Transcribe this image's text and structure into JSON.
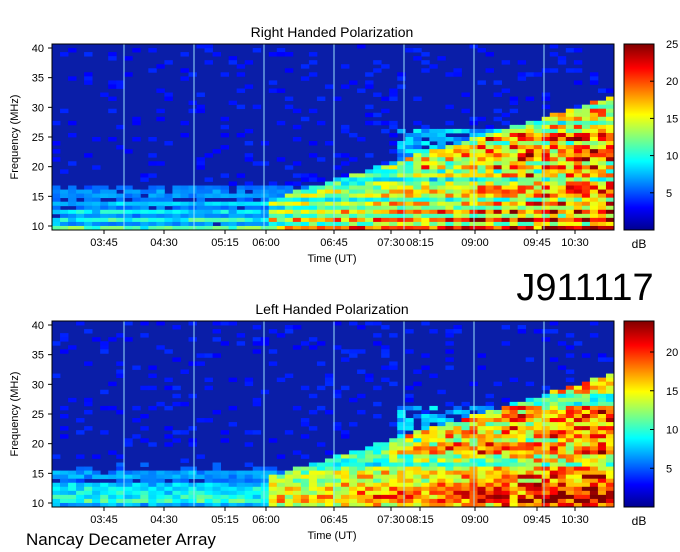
{
  "header": {
    "id_label": "J911117",
    "footer_label": "Nancay Decameter Array"
  },
  "chart_data": [
    {
      "type": "heatmap",
      "title": "Right Handed Polarization",
      "xlabel": "Time (UT)",
      "ylabel": "Frequency (MHz)",
      "x_ticks": [
        "03:45",
        "04:30",
        "05:15",
        "06:00",
        "06:45",
        "07:30",
        "08:15",
        "09:00",
        "09:45",
        "10:30"
      ],
      "y_ticks": [
        "10",
        "15",
        "20",
        "25",
        "30",
        "35",
        "40"
      ],
      "ylim": [
        10,
        40
      ],
      "colorbar": {
        "label": "dB",
        "ticks": [
          "5",
          "10",
          "15",
          "20",
          "25"
        ],
        "range": [
          0,
          25
        ]
      }
    },
    {
      "type": "heatmap",
      "title": "Left Handed Polarization",
      "xlabel": "Time (UT)",
      "ylabel": "Frequency (MHz)",
      "x_ticks": [
        "03:45",
        "04:30",
        "05:15",
        "06:00",
        "06:45",
        "07:30",
        "08:15",
        "09:00",
        "09:45",
        "10:30"
      ],
      "y_ticks": [
        "10",
        "15",
        "20",
        "25",
        "30",
        "35",
        "40"
      ],
      "ylim": [
        10,
        40
      ],
      "colorbar": {
        "label": "dB",
        "ticks": [
          "5",
          "10",
          "15",
          "20"
        ],
        "range": [
          0,
          24
        ]
      }
    }
  ]
}
